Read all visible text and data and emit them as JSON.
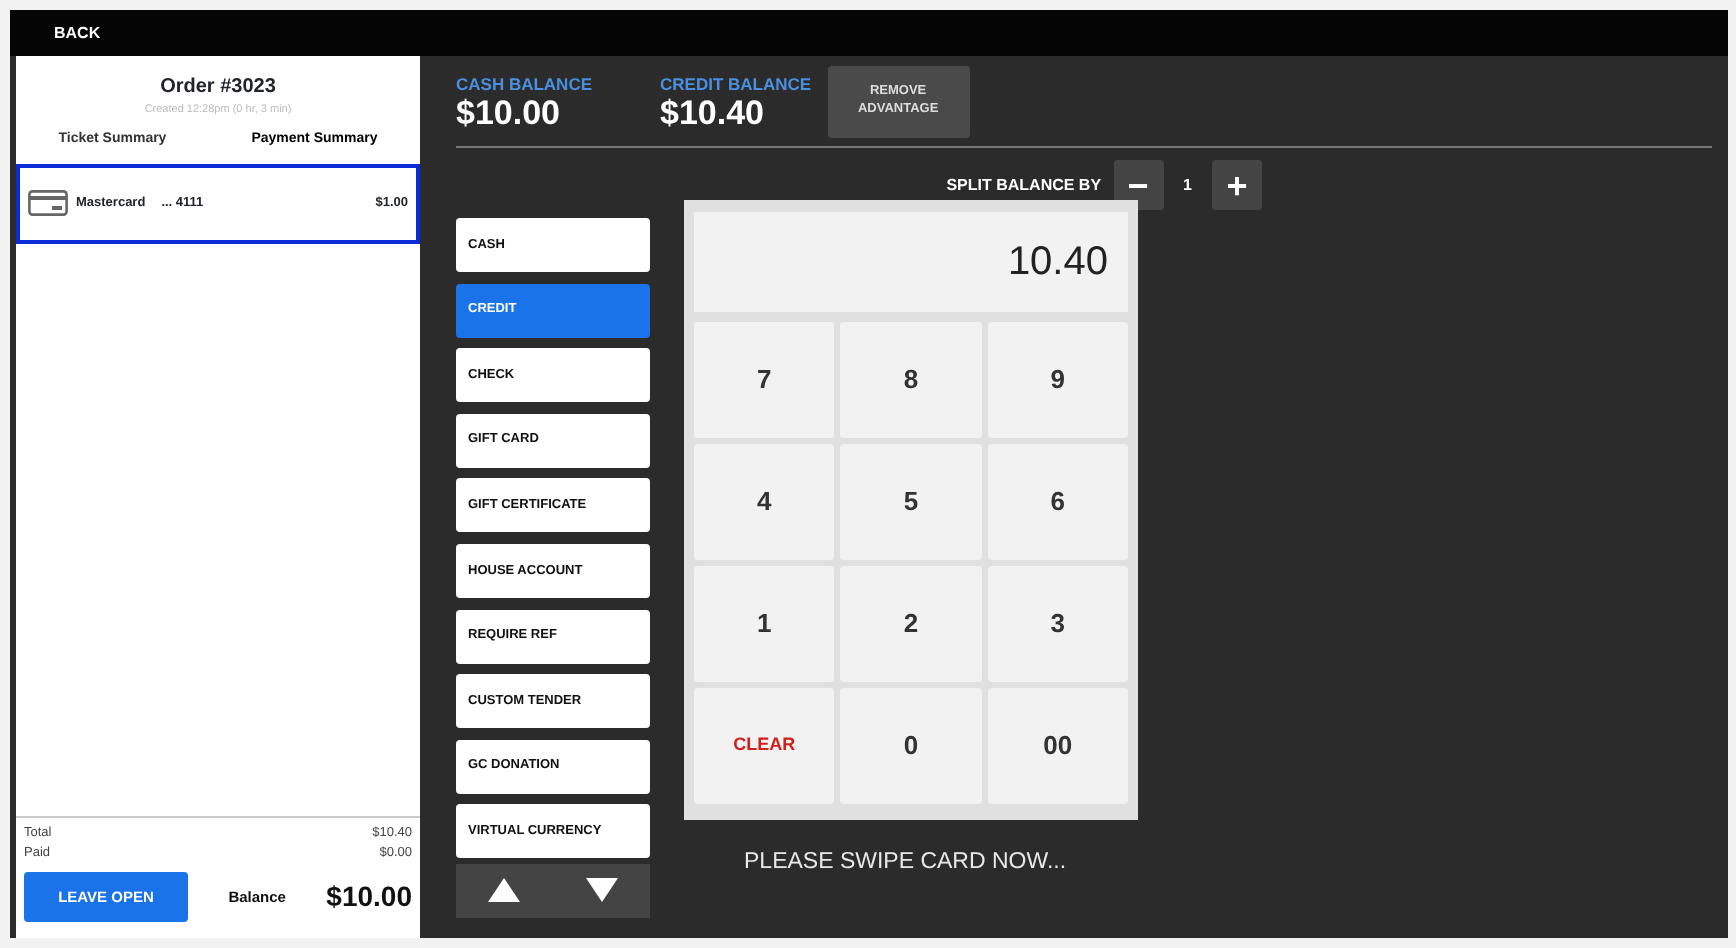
{
  "top_bar": {
    "back": "BACK"
  },
  "order": {
    "title": "Order #3023",
    "created": "Created 12:28pm (0 hr, 3 min)",
    "tabs": [
      {
        "label": "Ticket Summary",
        "selected": false
      },
      {
        "label": "Payment Summary",
        "selected": true
      }
    ],
    "payments": [
      {
        "name": "Mastercard",
        "last4": "... 4111",
        "amount": "$1.00",
        "selected": true
      }
    ],
    "totals": [
      {
        "label": "Total",
        "value": "$10.40"
      },
      {
        "label": "Paid",
        "value": "$0.00"
      }
    ],
    "leave_open": "LEAVE OPEN",
    "balance_label": "Balance",
    "balance": "$10.00"
  },
  "balances": [
    {
      "label": "CASH BALANCE",
      "value": "$10.00"
    },
    {
      "label": "CREDIT BALANCE",
      "value": "$10.40"
    }
  ],
  "remove_advantage": "REMOVE ADVANTAGE",
  "split": {
    "label": "SPLIT BALANCE BY",
    "minus": "−",
    "count": "1",
    "plus": "+"
  },
  "tenders": [
    {
      "label": "CASH",
      "selected": false
    },
    {
      "label": "CREDIT",
      "selected": true
    },
    {
      "label": "CHECK",
      "selected": false
    },
    {
      "label": "GIFT CARD",
      "selected": false
    },
    {
      "label": "GIFT CERTIFICATE",
      "selected": false
    },
    {
      "label": "HOUSE ACCOUNT",
      "selected": false
    },
    {
      "label": "REQUIRE REF",
      "selected": false
    },
    {
      "label": "CUSTOM TENDER",
      "selected": false
    },
    {
      "label": "GC DONATION",
      "selected": false
    },
    {
      "label": "VIRTUAL CURRENCY",
      "selected": false
    }
  ],
  "display": "10.40",
  "keys": [
    {
      "label": "7",
      "kind": "digit"
    },
    {
      "label": "8",
      "kind": "digit"
    },
    {
      "label": "9",
      "kind": "digit"
    },
    {
      "label": "4",
      "kind": "digit"
    },
    {
      "label": "5",
      "kind": "digit"
    },
    {
      "label": "6",
      "kind": "digit"
    },
    {
      "label": "1",
      "kind": "digit"
    },
    {
      "label": "2",
      "kind": "digit"
    },
    {
      "label": "3",
      "kind": "digit"
    },
    {
      "label": "CLEAR",
      "kind": "clear"
    },
    {
      "label": "0",
      "kind": "digit"
    },
    {
      "label": "00",
      "kind": "digit"
    }
  ],
  "message": "PLEASE SWIPE CARD NOW..."
}
